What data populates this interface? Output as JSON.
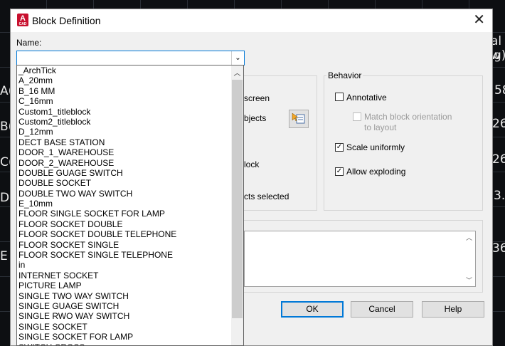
{
  "window": {
    "title": "Block Definition",
    "app_icon_letter": "A",
    "app_icon_sub": "CAD"
  },
  "name_field": {
    "label": "Name:",
    "value": ""
  },
  "background_text": [
    {
      "text": "al w",
      "style": "left:690px;top:48px;"
    },
    {
      "text": "g)",
      "style": "left:694px;top:68px;"
    },
    {
      "text": "A(",
      "style": "left:0px;top:118px;"
    },
    {
      "text": "58",
      "style": "left:695px;top:117px;"
    },
    {
      "text": "B(",
      "style": "left:0px;top:168px;"
    },
    {
      "text": "26",
      "style": "left:692px;top:164px;"
    },
    {
      "text": "C(",
      "style": "left:0px;top:218px;"
    },
    {
      "text": "26",
      "style": "left:692px;top:214px;"
    },
    {
      "text": "D(",
      "style": "left:0px;top:268px;"
    },
    {
      "text": "3.",
      "style": "left:694px;top:265px;"
    },
    {
      "text": "E",
      "style": "left:0px;top:350px;"
    },
    {
      "text": "36",
      "style": "left:692px;top:339px;"
    }
  ],
  "base_point": {
    "partial_label_1": "screen"
  },
  "objects": {
    "partial_label_1": "bjects",
    "partial_label_2": "lock",
    "partial_label_3": "cts selected"
  },
  "behavior": {
    "title": "Behavior",
    "annotative": {
      "label": "Annotative",
      "checked": false
    },
    "match_orientation": {
      "label_line1": "Match block orientation",
      "label_line2": "to layout",
      "checked": false,
      "enabled": false
    },
    "scale_uniformly": {
      "label": "Scale uniformly",
      "checked": true
    },
    "allow_exploding": {
      "label": "Allow exploding",
      "checked": true
    }
  },
  "buttons": {
    "ok": "OK",
    "cancel": "Cancel",
    "help": "Help"
  },
  "dropdown_items": [
    "_ArchTick",
    "A_20mm",
    "B_16 MM",
    "C_16mm",
    "Custom1_titleblock",
    "Custom2_titleblock",
    "D_12mm",
    "DECT BASE STATION",
    "DOOR_1_WAREHOUSE",
    "DOOR_2_WAREHOUSE",
    "DOUBLE GUAGE SWITCH",
    "DOUBLE SOCKET",
    "DOUBLE TWO WAY SWITCH",
    "E_10mm",
    "FLOOR SINGLE SOCKET FOR LAMP",
    "FLOOR SOCKET DOUBLE",
    "FLOOR SOCKET DOUBLE TELEPHONE",
    "FLOOR SOCKET SINGLE",
    "FLOOR SOCKET SINGLE TELEPHONE",
    "in",
    "INTERNET SOCKET",
    "PICTURE LAMP",
    "SINGLE  TWO WAY SWITCH",
    "SINGLE GUAGE SWITCH",
    "SINGLE RWO WAY SWITCH",
    "SINGLE SOCKET",
    "SINGLE SOCKET FOR LAMP",
    "SWITCH CROSS"
  ],
  "colors": {
    "accent": "#0078d7",
    "app_red": "#c8102e"
  }
}
